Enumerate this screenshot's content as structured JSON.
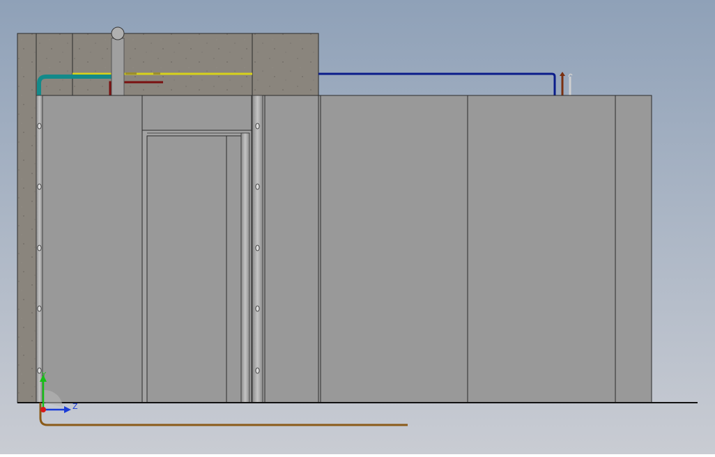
{
  "scene": {
    "background_top": "#8fa1b8",
    "background_bottom": "#c9ccd3",
    "concrete_color": "#8a857d",
    "panel_color": "#999999",
    "panel_edge_color": "#2a2a2a",
    "frame_color": "#a9a9a9"
  },
  "pipes": {
    "yellow": "#d8d21a",
    "navy": "#0a1c8a",
    "teal": "#138a8a",
    "dark_red": "#7a1010",
    "brown": "#8a5a18",
    "grey_duct": "#a0a0a0"
  },
  "triad": {
    "y_label": "Y",
    "z_label": "Z",
    "y_color": "#16c016",
    "z_color": "#1a3cd8",
    "x_color": "#d81a1a"
  },
  "icons": {
    "axis": "axis-triad-icon"
  }
}
